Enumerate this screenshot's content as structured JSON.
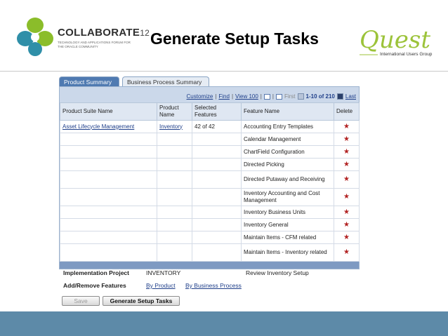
{
  "header": {
    "collab_word": "COLLABORATE",
    "collab_num": "12",
    "collab_sub": "TECHNOLOGY AND APPLICATIONS FORUM FOR THE ORACLE COMMUNITY",
    "title": "Generate Setup Tasks",
    "quest_sub": "International Users Group"
  },
  "tabs": [
    {
      "label": "Product Summary",
      "active": true
    },
    {
      "label": "Business Process Summary",
      "active": false
    }
  ],
  "grid_nav": {
    "customize": "Customize",
    "find": "Find",
    "view": "View 100",
    "first": "First",
    "range": "1-10 of 210",
    "last": "Last"
  },
  "table": {
    "headers": [
      "Product Suite Name",
      "Product Name",
      "Selected Features",
      "Feature Name",
      "Delete"
    ],
    "first_row": {
      "suite": "Asset Lifecycle Management",
      "product": "Inventory",
      "selected": "42 of 42"
    },
    "features": [
      "Accounting Entry Templates",
      "Calendar Management",
      "ChartField Configuration",
      "Directed Picking",
      "Directed Putaway and Receiving",
      "Inventory Accounting and Cost Management",
      "Inventory Business Units",
      "Inventory General",
      "Maintain Items - CFM related",
      "Maintain Items - Inventory related"
    ],
    "delete_symbol": "★"
  },
  "form": {
    "impl_label": "Implementation Project",
    "impl_value": "INVENTORY",
    "review_label": "Review Inventory Setup",
    "addremove_label": "Add/Remove Features",
    "by_product": "By Product",
    "by_business_process": "By Business Process",
    "save_label": "Save",
    "generate_label": "Generate Setup Tasks"
  },
  "colors": {
    "tab_active": "#4f7ab1",
    "grid_header": "#cbd8ea",
    "star": "#b22222",
    "bottom_bar": "#5d8aa8"
  }
}
